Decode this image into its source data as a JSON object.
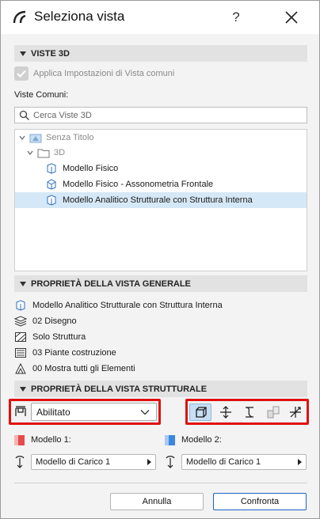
{
  "window": {
    "title": "Seleziona vista",
    "help_label": "?"
  },
  "section_3d": {
    "header": "VISTE 3D",
    "checkbox_label": "Applica Impostazioni di Vista comuni",
    "checkbox_checked": true,
    "common_views_label": "Viste Comuni:",
    "search_placeholder": "Cerca Viste 3D",
    "tree": {
      "root": "Senza Titolo",
      "folder": "3D",
      "items": [
        "Modello Fisico",
        "Modello Fisico - Assonometria Frontale",
        "Modello Analitico Strutturale con Struttura Interna"
      ],
      "selected_index": 2
    }
  },
  "section_general": {
    "header": "PROPRIETÀ DELLA VISTA GENERALE",
    "rows": [
      {
        "icon": "view-cube-icon",
        "text": "Modello Analitico Strutturale con Struttura Interna"
      },
      {
        "icon": "layers-icon",
        "text": "02 Disegno"
      },
      {
        "icon": "structure-hatch-icon",
        "text": "Solo Struttura"
      },
      {
        "icon": "floor-plan-icon",
        "text": "03 Piante costruzione"
      },
      {
        "icon": "elements-icon",
        "text": "00 Mostra tutti gli Elementi"
      }
    ]
  },
  "section_structural": {
    "header": "PROPRIETÀ DELLA VISTA STRUTTURALE",
    "mode_value": "Abilitato",
    "model1_label": "Modello 1:",
    "model2_label": "Modello 2:",
    "model1_load": "Modello di Carico 1",
    "model2_load": "Modello di Carico 1",
    "colors": {
      "model1": "#e84a4a",
      "model2": "#3b86e0",
      "highlight": "#e01010"
    }
  },
  "buttons": {
    "cancel": "Annulla",
    "compare": "Confronta"
  }
}
